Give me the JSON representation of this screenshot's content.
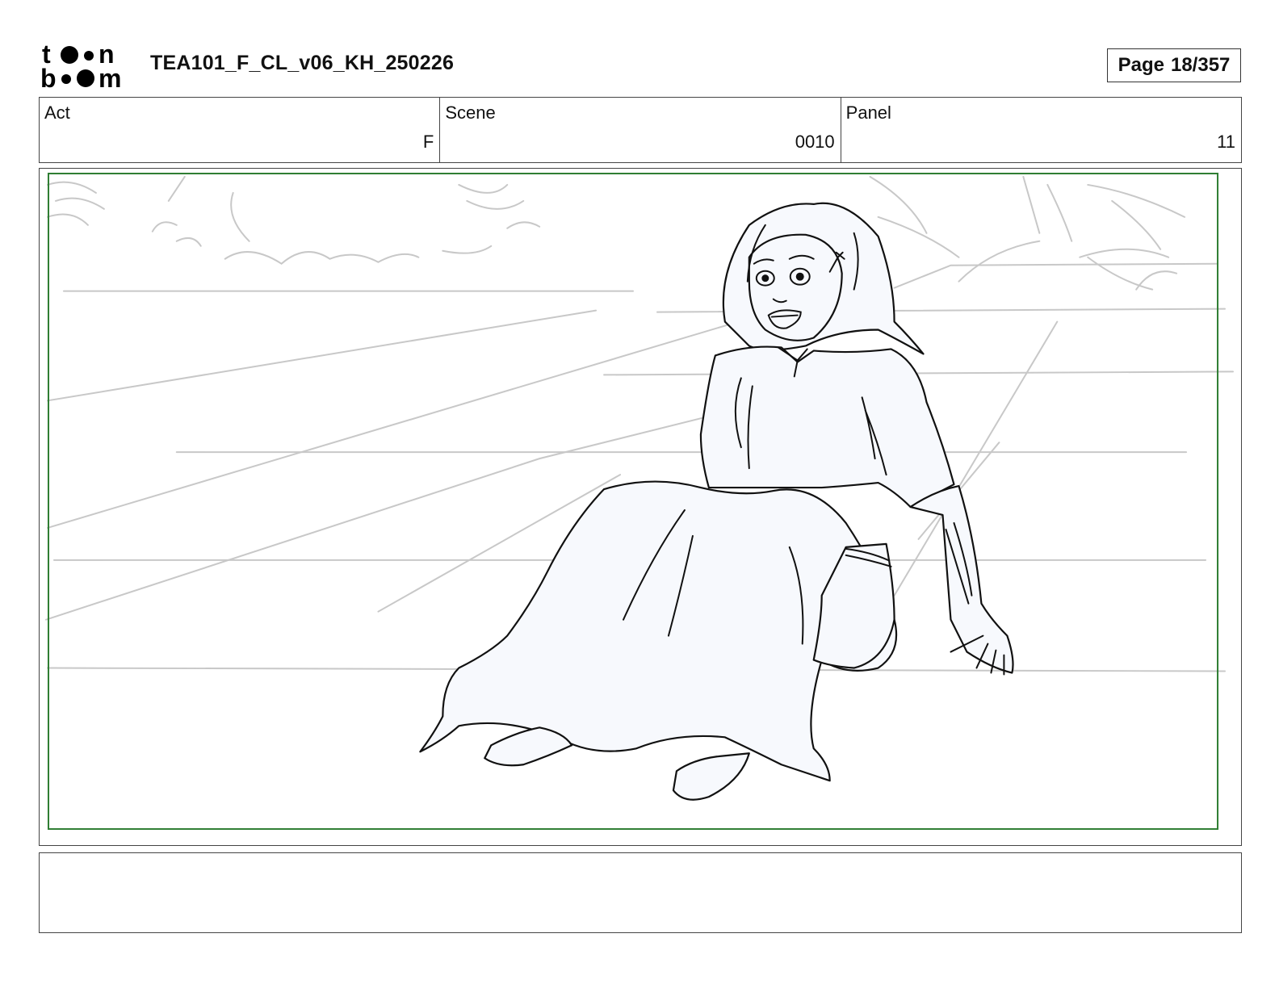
{
  "header": {
    "logo_text": "toon boom",
    "document_title": "TEA101_F_CL_v06_KH_250226",
    "page_label": "Page",
    "page_number": "18/357"
  },
  "info": {
    "act": {
      "label": "Act",
      "value": "F"
    },
    "scene": {
      "label": "Scene",
      "value": "0010"
    },
    "panel": {
      "label": "Panel",
      "value": "11"
    }
  },
  "colors": {
    "safe_frame": "#2e7d32",
    "sketch_line": "#111111",
    "background_line": "#c8c8c8",
    "figure_fill": "#f7f9fd"
  },
  "notes": {
    "text": ""
  }
}
